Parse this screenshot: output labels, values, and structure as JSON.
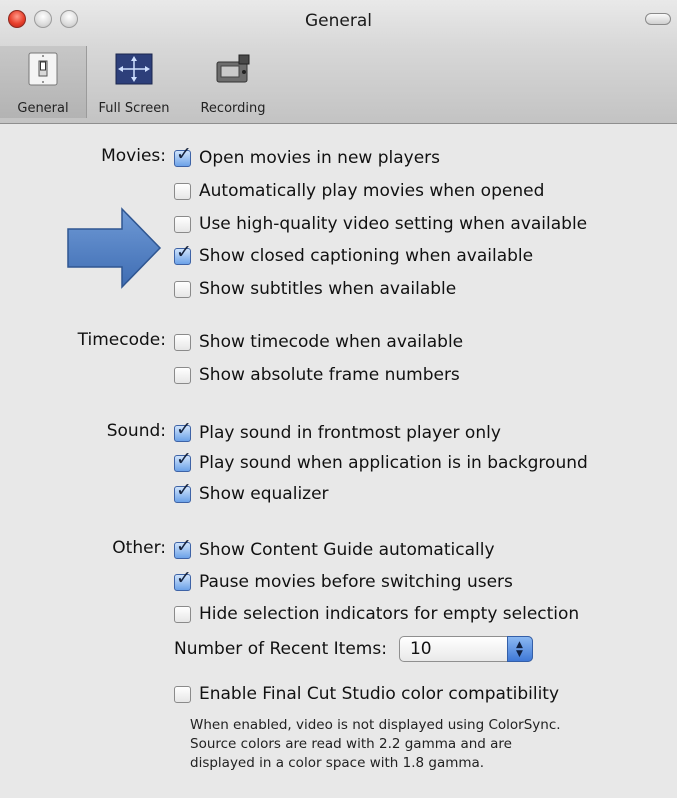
{
  "window": {
    "title": "General"
  },
  "toolbar": {
    "items": [
      {
        "label": "General",
        "selected": true,
        "icon": "light-switch-icon"
      },
      {
        "label": "Full Screen",
        "selected": false,
        "icon": "full-screen-arrows-icon"
      },
      {
        "label": "Recording",
        "selected": false,
        "icon": "video-camera-icon"
      }
    ]
  },
  "sections": [
    {
      "label": "Movies:",
      "options": [
        {
          "text": "Open movies in new players",
          "checked": true
        },
        {
          "text": "Automatically play movies when opened",
          "checked": false
        },
        {
          "text": "Use high-quality video setting when available",
          "checked": false
        },
        {
          "text": "Show closed captioning when available",
          "checked": true
        },
        {
          "text": "Show subtitles when available",
          "checked": false
        }
      ]
    },
    {
      "label": "Timecode:",
      "options": [
        {
          "text": "Show timecode when available",
          "checked": false
        },
        {
          "text": "Show absolute frame numbers",
          "checked": false
        }
      ]
    },
    {
      "label": "Sound:",
      "options": [
        {
          "text": "Play sound in frontmost player only",
          "checked": true
        },
        {
          "text": "Play sound when application is in background",
          "checked": true
        },
        {
          "text": "Show equalizer",
          "checked": true
        }
      ]
    },
    {
      "label": "Other:",
      "options": [
        {
          "text": "Show Content Guide automatically",
          "checked": true
        },
        {
          "text": "Pause movies before switching users",
          "checked": true
        },
        {
          "text": "Hide selection indicators for empty selection",
          "checked": false
        }
      ]
    }
  ],
  "recent_items": {
    "label": "Number of Recent Items:",
    "value": "10"
  },
  "final_cut": {
    "text": "Enable Final Cut Studio color compatibility",
    "checked": false,
    "description": [
      "When enabled, video is not displayed using ColorSync.",
      "Source colors are read with 2.2 gamma and are",
      "displayed in a color space with 1.8 gamma."
    ]
  },
  "colors": {
    "annotation_arrow": "#4f81bd",
    "checkbox_on": "#6ca2e8"
  }
}
